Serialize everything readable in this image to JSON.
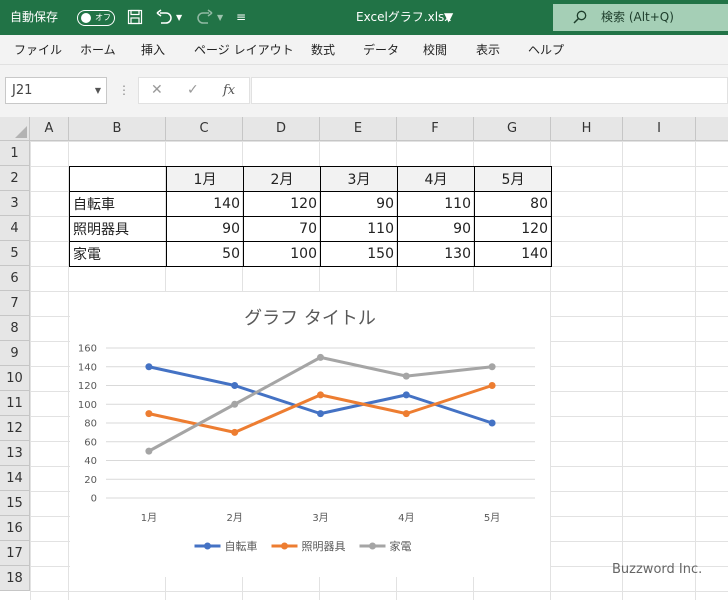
{
  "titlebar": {
    "autosave_label": "自動保存",
    "autosave_state": "オフ",
    "document_title": "Excelグラフ.xlsx",
    "search_placeholder": "検索 (Alt+Q)",
    "bg_color": "#217346"
  },
  "menu": [
    "ファイル",
    "ホーム",
    "挿入",
    "ページ レイアウト",
    "数式",
    "データ",
    "校閲",
    "表示",
    "ヘルプ"
  ],
  "formula_bar": {
    "name_box": "J21",
    "fx_label": "fx",
    "formula": ""
  },
  "grid": {
    "columns": [
      "A",
      "B",
      "C",
      "D",
      "E",
      "F",
      "G",
      "H",
      "I"
    ],
    "rows": [
      "1",
      "2",
      "3",
      "4",
      "5",
      "6",
      "7",
      "8",
      "9",
      "10",
      "11",
      "12",
      "13",
      "14",
      "15",
      "16",
      "17",
      "18"
    ]
  },
  "table": {
    "headers": [
      "",
      "1月",
      "2月",
      "3月",
      "4月",
      "5月"
    ],
    "rows": [
      {
        "label": "自転車",
        "values": [
          "140",
          "120",
          "90",
          "110",
          "80"
        ]
      },
      {
        "label": "照明器具",
        "values": [
          "90",
          "70",
          "110",
          "90",
          "120"
        ]
      },
      {
        "label": "家電",
        "values": [
          "50",
          "100",
          "150",
          "130",
          "140"
        ]
      }
    ]
  },
  "chart_data": {
    "type": "line",
    "title": "グラフ タイトル",
    "categories": [
      "1月",
      "2月",
      "3月",
      "4月",
      "5月"
    ],
    "series": [
      {
        "name": "自転車",
        "color": "#4472c4",
        "values": [
          140,
          120,
          90,
          110,
          80
        ]
      },
      {
        "name": "照明器具",
        "color": "#ed7d31",
        "values": [
          90,
          70,
          110,
          90,
          120
        ]
      },
      {
        "name": "家電",
        "color": "#a5a5a5",
        "values": [
          50,
          100,
          150,
          130,
          140
        ]
      }
    ],
    "ylim": [
      0,
      160
    ],
    "yticks": [
      "0",
      "20",
      "40",
      "60",
      "80",
      "100",
      "120",
      "140",
      "160"
    ],
    "grid": true,
    "legend": "bottom"
  },
  "watermark": "Buzzword Inc."
}
